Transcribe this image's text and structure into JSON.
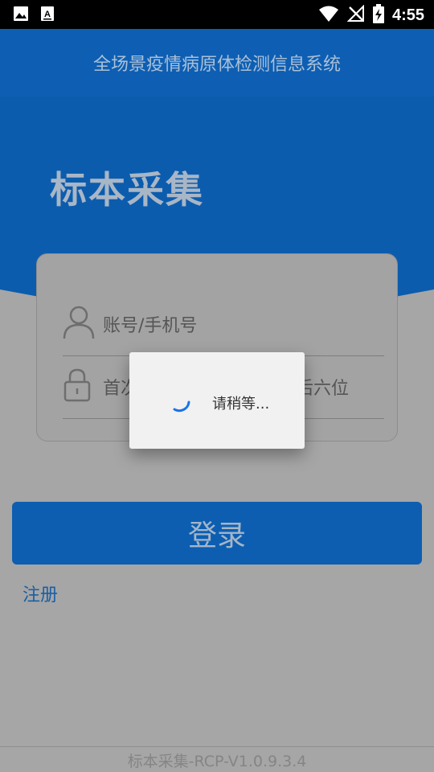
{
  "status": {
    "time": "4:55",
    "left_icons": [
      "image-icon",
      "text-a-icon"
    ],
    "right_icons": [
      "wifi-icon",
      "no-signal-icon",
      "battery-charging-icon"
    ]
  },
  "appbar": {
    "title": "全场景疫情病原体检测信息系统"
  },
  "hero": {
    "title": "标本采集"
  },
  "form": {
    "account_placeholder": "账号/手机号",
    "password_placeholder_start": "首次",
    "password_placeholder_end": "后六位"
  },
  "login": {
    "label": "登录"
  },
  "register": {
    "label": "注册"
  },
  "footer": {
    "version": "标本采集-RCP-V1.0.9.3.4"
  },
  "dialog": {
    "message": "请稍等..."
  },
  "colors": {
    "brand": "#0e5fb3",
    "scrim": "#a6a6a6",
    "spinner": "#1a73e8"
  }
}
